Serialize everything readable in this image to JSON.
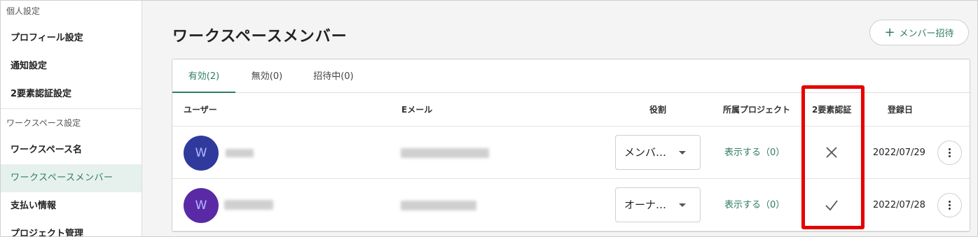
{
  "sidebar": {
    "personal_header": "個人設定",
    "personal_items": [
      {
        "label": "プロフィール設定"
      },
      {
        "label": "通知設定"
      },
      {
        "label": "2要素認証設定"
      }
    ],
    "workspace_header": "ワークスペース設定",
    "workspace_items": [
      {
        "label": "ワークスペース名",
        "active": false
      },
      {
        "label": "ワークスペースメンバー",
        "active": true
      },
      {
        "label": "支払い情報",
        "active": false
      },
      {
        "label": "プロジェクト管理",
        "active": false
      }
    ]
  },
  "main": {
    "title": "ワークスペースメンバー",
    "invite_button": "メンバー招待",
    "tabs": [
      {
        "label": "有効(2)",
        "active": true
      },
      {
        "label": "無効(0)",
        "active": false
      },
      {
        "label": "招待中(0)",
        "active": false
      }
    ],
    "columns": {
      "user": "ユーザー",
      "email": "Eメール",
      "role": "役割",
      "projects": "所属プロジェクト",
      "two_factor": "2要素認証",
      "registered": "登録日"
    },
    "members": [
      {
        "avatar_initial": "W",
        "avatar_color": "#2f3a9c",
        "role": "メンバ…",
        "projects_link": "表示する（0）",
        "two_factor_enabled": false,
        "registered": "2022/07/29"
      },
      {
        "avatar_initial": "W",
        "avatar_color": "#5a2aa6",
        "role": "オーナ…",
        "projects_link": "表示する（0）",
        "two_factor_enabled": true,
        "registered": "2022/07/28"
      }
    ]
  },
  "colors": {
    "accent": "#2e7d63",
    "highlight": "#e60000"
  }
}
